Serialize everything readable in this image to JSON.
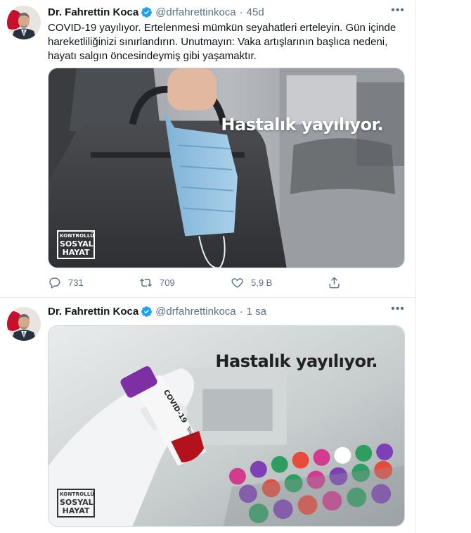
{
  "tweets": [
    {
      "author": {
        "name": "Dr. Fahrettin Koca",
        "handle": "@drfahrettinkoca"
      },
      "separator": "·",
      "time": "45d",
      "more_icon": "•••",
      "text": "COVID-19 yayılıyor. Ertelenmesi mümkün seyahatleri erteleyin. Gün içinde hareketliliğinizi sınırlandırın. Unutmayın: Vaka artışlarının başlıca nedeni, hayatı salgın öncesindeymiş gibi yaşamaktır.",
      "media": {
        "caption": "Hastalık yayılıyor.",
        "badge": {
          "line1": "KONTROLLÜ",
          "line2": "SOSYAL",
          "line3": "HAYAT"
        }
      },
      "actions": {
        "reply": {
          "icon": "reply-icon",
          "count": "731"
        },
        "retweet": {
          "icon": "retweet-icon",
          "count": "709"
        },
        "like": {
          "icon": "like-icon",
          "count": "5,9 B"
        },
        "share": {
          "icon": "share-icon"
        }
      }
    },
    {
      "author": {
        "name": "Dr. Fahrettin Koca",
        "handle": "@drfahrettinkoca"
      },
      "separator": "·",
      "time": "1 sa",
      "more_icon": "•••",
      "media": {
        "caption": "Hastalık yayılıyor.",
        "tube_label": "COVID-19",
        "tube_sublabel": "Test",
        "badge": {
          "line1": "KONTROLLÜ",
          "line2": "SOSYAL",
          "line3": "HAYAT"
        }
      }
    }
  ],
  "colors": {
    "text": "#0f1419",
    "secondary": "#5b7083",
    "verified": "#1da1f2",
    "border": "#e6ecf0"
  }
}
